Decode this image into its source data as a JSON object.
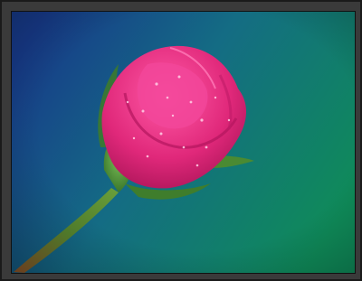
{
  "image": {
    "subject": "",
    "background_colors": [
      "#1b3f8c",
      "#1a6a7a",
      "#0f8a5a"
    ],
    "petal_color": "#e8307a",
    "stem_color": "#4f7a2a"
  },
  "signature_text": ""
}
